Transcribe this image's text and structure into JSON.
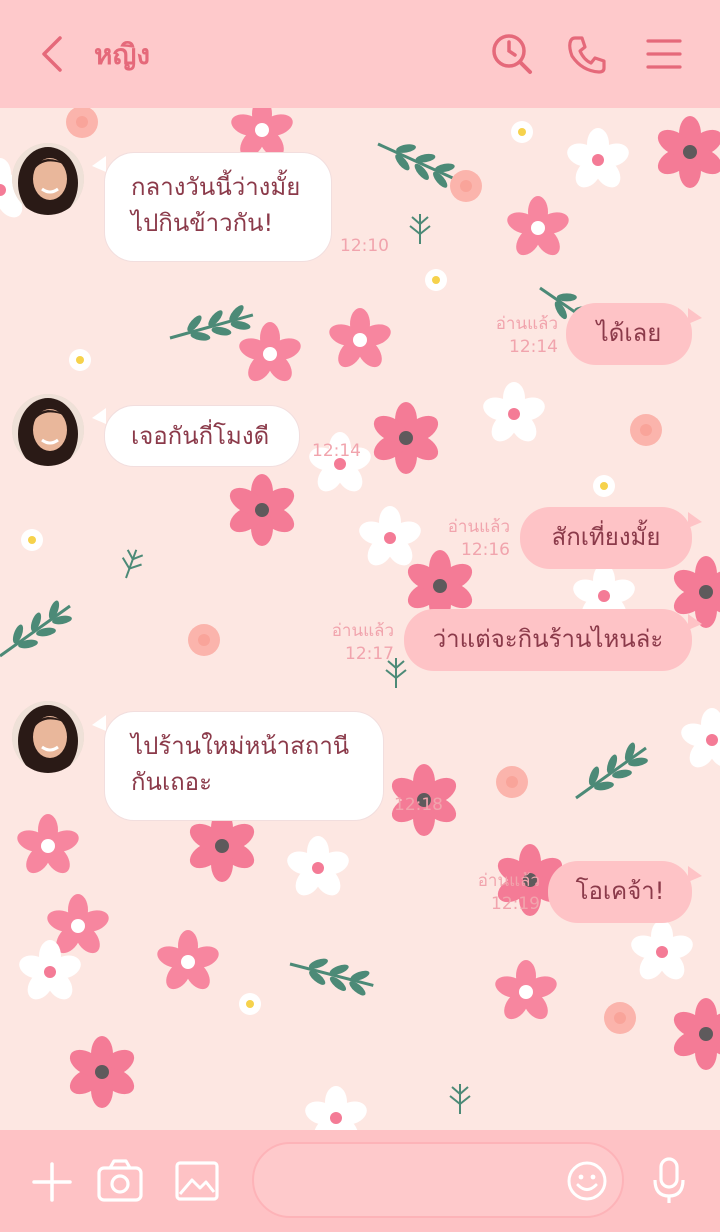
{
  "header": {
    "title": "หญิง",
    "back_icon": "chevron-left-icon",
    "icons": [
      "clock-search-icon",
      "phone-icon",
      "menu-icon"
    ],
    "accent_color": "#e5697a",
    "bg_color": "#fec9cb"
  },
  "messages": [
    {
      "side": "in",
      "lines": [
        "กลางวันนี้ว่างมั้ย",
        "ไปกินข้าวกัน!"
      ],
      "time": "12:10",
      "read": ""
    },
    {
      "side": "out",
      "lines": [
        "ได้เลย"
      ],
      "time": "12:14",
      "read": "อ่านแล้ว"
    },
    {
      "side": "in",
      "lines": [
        "เจอกันกี่โมงดี"
      ],
      "time": "12:14",
      "read": ""
    },
    {
      "side": "out",
      "lines": [
        "สักเที่ยงมั้ย"
      ],
      "time": "12:16",
      "read": "อ่านแล้ว"
    },
    {
      "side": "out",
      "lines": [
        "ว่าแต่จะกินร้านไหนล่ะ"
      ],
      "time": "12:17",
      "read": "อ่านแล้ว"
    },
    {
      "side": "in",
      "lines": [
        "ไปร้านใหม่หน้าสถานี",
        "กันเถอะ"
      ],
      "time": "12:18",
      "read": ""
    },
    {
      "side": "out",
      "lines": [
        "โอเคจ้า!"
      ],
      "time": "12:19",
      "read": "อ่านแล้ว"
    }
  ],
  "footer": {
    "icons": [
      "plus-icon",
      "camera-icon",
      "image-icon",
      "emoji-icon",
      "microphone-icon"
    ],
    "input_placeholder": ""
  }
}
